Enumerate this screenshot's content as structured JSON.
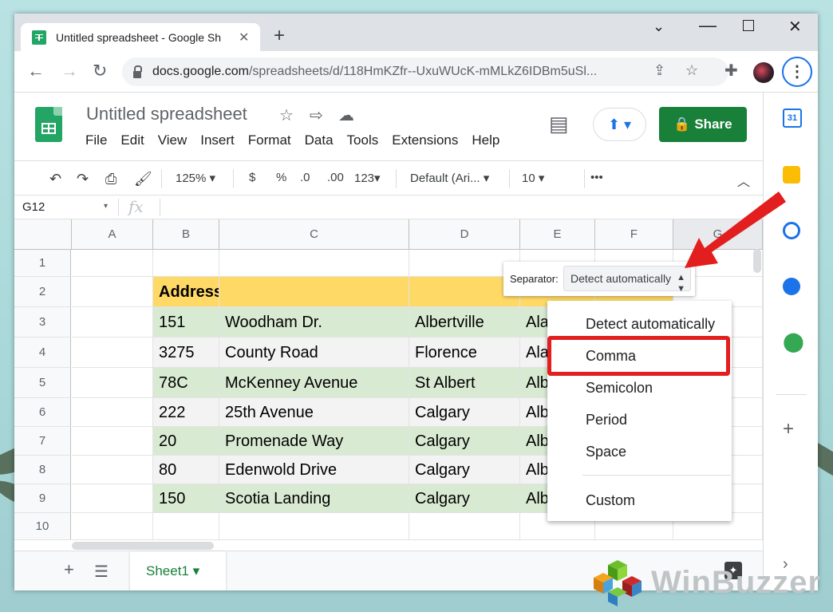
{
  "browser": {
    "tab_title": "Untitled spreadsheet - Google Sh",
    "url_host": "docs.google.com",
    "url_path": "/spreadsheets/d/118HmKZfr--UxuWUcK-mMLkZ6IDBm5uSl..."
  },
  "doc": {
    "title": "Untitled spreadsheet",
    "menus": [
      "File",
      "Edit",
      "View",
      "Insert",
      "Format",
      "Data",
      "Tools",
      "Extensions",
      "Help"
    ],
    "share_label": "Share"
  },
  "toolbar": {
    "zoom": "125%",
    "currency": "$",
    "percent": "%",
    "dec_less": ".0",
    "dec_more": ".00",
    "format_more": "123",
    "font": "Default (Ari...",
    "font_size": "10",
    "more": "•••"
  },
  "formula_bar": {
    "cell_ref": "G12",
    "fx": "fx"
  },
  "columns": [
    "A",
    "B",
    "C",
    "D",
    "E",
    "F",
    "G"
  ],
  "rows": [
    "1",
    "2",
    "3",
    "4",
    "5",
    "6",
    "7",
    "8",
    "9",
    "10"
  ],
  "header": {
    "address": "Address"
  },
  "data_rows": [
    [
      "151",
      "Woodham Dr.",
      "Albertville",
      "Ala"
    ],
    [
      "3275",
      "County Road",
      "Florence",
      "Ala"
    ],
    [
      "78C",
      "McKenney Avenue",
      "St Albert",
      "Alb"
    ],
    [
      "222",
      "25th Avenue",
      "Calgary",
      "Alb"
    ],
    [
      "20",
      "Promenade Way",
      "Calgary",
      "Alb"
    ],
    [
      "80",
      "Edenwold Drive",
      "Calgary",
      "Alb"
    ],
    [
      "150",
      "Scotia Landing",
      "Calgary",
      "Alb"
    ]
  ],
  "separator": {
    "label": "Separator:",
    "selected": "Detect automatically",
    "options": [
      "Detect automatically",
      "Comma",
      "Semicolon",
      "Period",
      "Space",
      "Custom"
    ],
    "highlighted": "Comma"
  },
  "sheet_tab": "Sheet1",
  "watermark": "WinBuzzer",
  "colors": {
    "green": "#188038",
    "header_fill": "#ffd966",
    "row_green": "#d9ead3",
    "row_gray": "#f3f3f3",
    "highlight": "#e21e1e"
  }
}
